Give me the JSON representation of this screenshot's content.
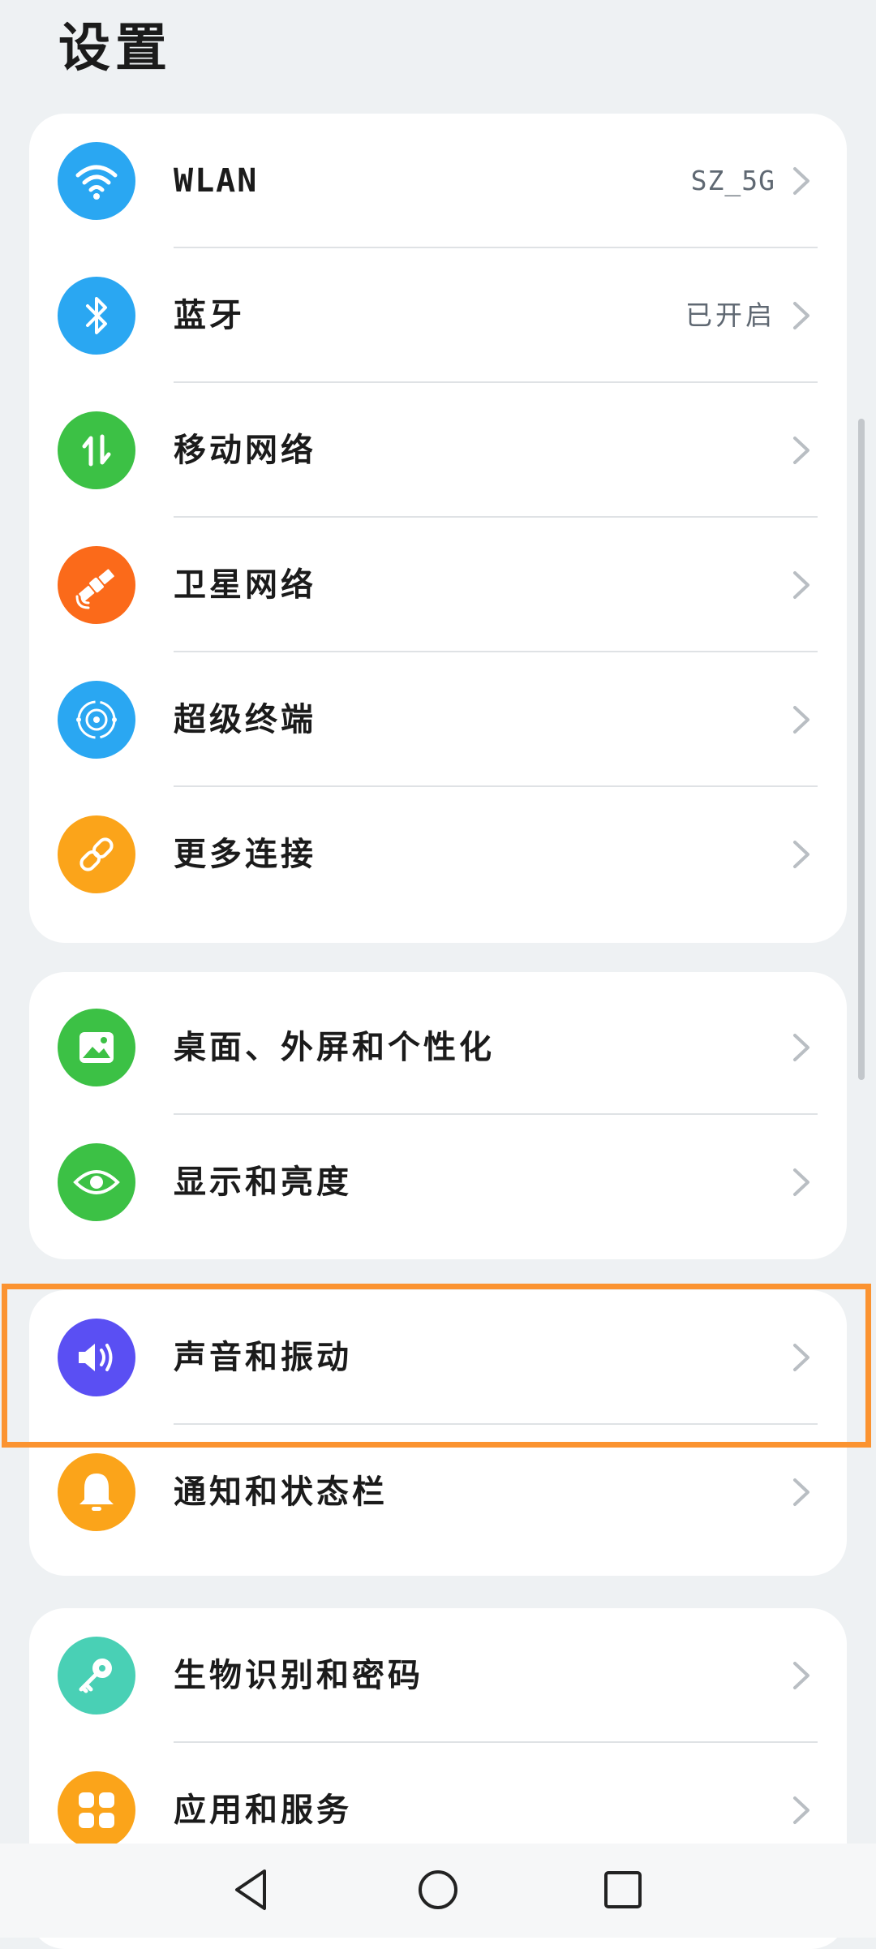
{
  "header": {
    "title": "设置"
  },
  "groups": [
    {
      "items": [
        {
          "label": "WLAN",
          "value": "SZ_5G",
          "icon": "wifi-icon",
          "color": "#2aa7f2"
        },
        {
          "label": "蓝牙",
          "value": "已开启",
          "icon": "bluetooth-icon",
          "color": "#2aa7f2"
        },
        {
          "label": "移动网络",
          "value": "",
          "icon": "mobile-data-icon",
          "color": "#3cc145"
        },
        {
          "label": "卫星网络",
          "value": "",
          "icon": "satellite-icon",
          "color": "#fb6a1a"
        },
        {
          "label": "超级终端",
          "value": "",
          "icon": "super-device-icon",
          "color": "#2aa7f2"
        },
        {
          "label": "更多连接",
          "value": "",
          "icon": "link-icon",
          "color": "#fba41a"
        }
      ]
    },
    {
      "items": [
        {
          "label": "桌面、外屏和个性化",
          "icon": "wallpaper-icon",
          "color": "#3cc145"
        },
        {
          "label": "显示和亮度",
          "icon": "eye-icon",
          "color": "#3cc145"
        }
      ]
    },
    {
      "items": [
        {
          "label": "声音和振动",
          "icon": "sound-icon",
          "color": "#5a4ff3"
        },
        {
          "label": "通知和状态栏",
          "icon": "bell-icon",
          "color": "#fba41a"
        }
      ]
    },
    {
      "items": [
        {
          "label": "生物识别和密码",
          "icon": "key-icon",
          "color": "#49d0b5"
        },
        {
          "label": "应用和服务",
          "icon": "apps-icon",
          "color": "#fba41a"
        }
      ]
    }
  ],
  "highlight_color": "#fb9330",
  "navbar": {
    "icons": [
      "back-icon",
      "home-icon",
      "recents-icon"
    ]
  }
}
